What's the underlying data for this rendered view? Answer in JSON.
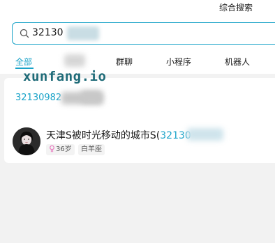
{
  "header": {
    "mode_label": "综合搜索"
  },
  "search": {
    "query": "32130"
  },
  "tabs": [
    {
      "label": "全部",
      "active": true
    },
    {
      "label": "群聊",
      "active": false
    },
    {
      "label": "小程序",
      "active": false
    },
    {
      "label": "机器人",
      "active": false
    }
  ],
  "watermark": "xunfang.io",
  "results": {
    "number_text": "32130982",
    "user": {
      "name_prefix": "天津S被时光移动的城市S(",
      "name_match": "32130",
      "age": "36岁",
      "zodiac": "白羊座"
    }
  },
  "colors": {
    "accent": "#1aa3c8",
    "female": "#e87cc0"
  }
}
